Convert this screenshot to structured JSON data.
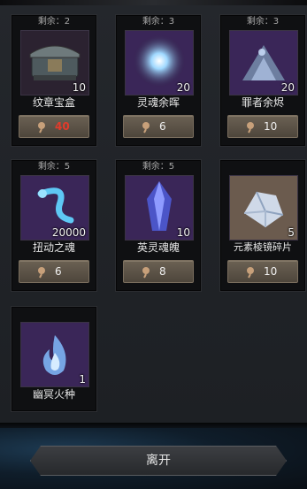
{
  "shop": {
    "items": [
      {
        "remain": "剩余：2",
        "name": "纹章宝盒",
        "qty": "10",
        "price": "40",
        "price_red": true,
        "icon": "chest-icon"
      },
      {
        "remain": "剩余：3",
        "name": "灵魂余晖",
        "qty": "20",
        "price": "6",
        "price_red": false,
        "icon": "soul-glow-icon"
      },
      {
        "remain": "剩余：3",
        "name": "罪者余烬",
        "qty": "20",
        "price": "10",
        "price_red": false,
        "icon": "ember-pile-icon"
      },
      {
        "remain": "剩余：5",
        "name": "扭动之魂",
        "qty": "20000",
        "price": "6",
        "price_red": false,
        "icon": "twisting-soul-icon"
      },
      {
        "remain": "剩余：5",
        "name": "英灵魂魄",
        "qty": "10",
        "price": "8",
        "price_red": false,
        "icon": "blue-crystal-icon"
      },
      {
        "remain": "",
        "name": "元素棱镜碎片",
        "qty": "5",
        "price": "10",
        "price_red": false,
        "icon": "prism-shard-icon"
      },
      {
        "remain": "",
        "name": "幽冥火种",
        "qty": "1",
        "price": "",
        "price_red": false,
        "icon": "spirit-flame-icon"
      }
    ],
    "currency_icon": "shard-coin-icon"
  },
  "footer": {
    "leave_label": "离开"
  },
  "colors": {
    "price_red": "#e23b2b",
    "price_bg": "#5d5447",
    "card_bg": "#0f1012",
    "item_bg_purple": "#4a2c6a"
  }
}
